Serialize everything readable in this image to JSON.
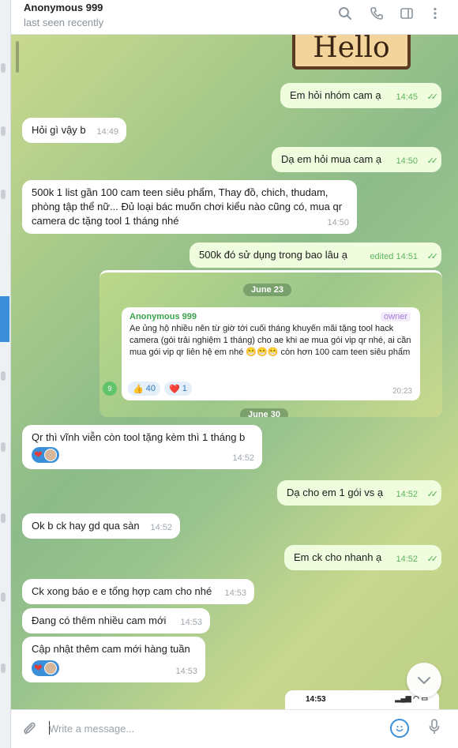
{
  "header": {
    "contact_name": "Anonymous 999",
    "status": "last seen recently",
    "icons": [
      "search-icon",
      "phone-icon",
      "sidebar-toggle-icon",
      "more-vert-icon"
    ]
  },
  "sticker": {
    "text": "Hello"
  },
  "messages": [
    {
      "dir": "out",
      "text": "Em hỏi nhóm cam ạ",
      "time": "14:45"
    },
    {
      "dir": "in",
      "text": "Hỏi gì vậy b",
      "time": "14:49"
    },
    {
      "dir": "out",
      "text": "Dạ em hỏi mua cam ạ",
      "time": "14:50"
    },
    {
      "dir": "in",
      "text": "500k 1 list gần 100 cam teen siêu phẩm, Thay đồ, chich, thudam, phòng tập thể nữ... Đủ loại bác muốn chơi kiểu nào cũng có, mua qr camera dc tặng tool 1 tháng nhé",
      "time": "14:50"
    },
    {
      "dir": "out",
      "text": "500k đó sử dụng trong bao lâu ạ",
      "time": "edited 14:51"
    },
    {
      "dir": "in",
      "text": "Qr thì vĩnh viễn còn tool tặng kèm thì 1 tháng b",
      "time": "14:52"
    },
    {
      "dir": "out",
      "text": "Dạ cho em 1 gói vs ạ",
      "time": "14:52"
    },
    {
      "dir": "in",
      "text": "Ok b ck hay gd qua sàn",
      "time": "14:52"
    },
    {
      "dir": "out",
      "text": "Em ck cho nhanh ạ",
      "time": "14:52"
    },
    {
      "dir": "in",
      "text": "Ck xong báo e e tổng hợp cam cho nhé",
      "time": "14:53"
    },
    {
      "dir": "in",
      "text": "Đang có thêm nhiều cam mới",
      "time": "14:53"
    },
    {
      "dir": "in",
      "text": "Cập nhật thêm cam mới hàng tuần",
      "time": "14:53"
    }
  ],
  "embedded_screenshot": {
    "date_top": "June 23",
    "date_bottom": "June 30",
    "sender": "Anonymous 999",
    "owner_badge": "owner",
    "text": "Ae ủng hộ nhiều nên từ giờ tới cuối tháng khuyến mãi tặng tool hack camera (gói trải nghiệm 1 tháng) cho ae khi ae mua gói vip qr nhé, ai cần mua gói vip qr liên hệ em nhé 😁😁😁 còn hơn 100 cam teen siêu phẩm",
    "time": "20:23",
    "reactions": [
      {
        "emoji": "👍",
        "count": "40"
      },
      {
        "emoji": "❤️",
        "count": "1"
      }
    ]
  },
  "mini_phone": {
    "time": "14:53"
  },
  "composer": {
    "placeholder": "Write a message..."
  },
  "colors": {
    "accent": "#3a8fd8",
    "outgoing_bubble": "#effdde",
    "incoming_bubble": "#ffffff",
    "check_green": "#4fae4e"
  }
}
